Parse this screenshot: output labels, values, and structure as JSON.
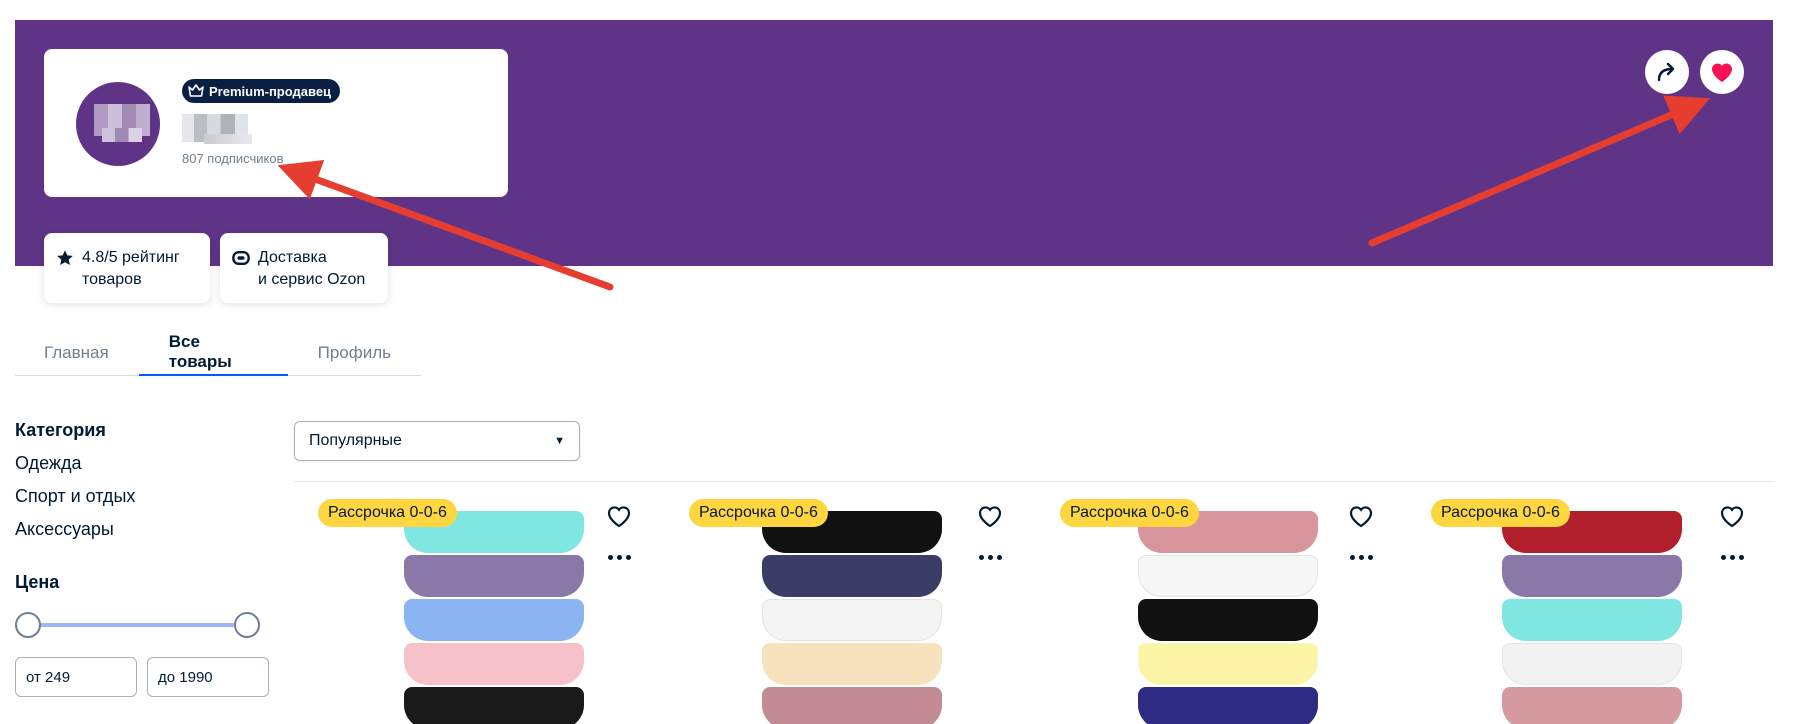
{
  "colors": {
    "banner": "#5f3487",
    "accent": "#005bff",
    "badge": "#ffd640",
    "heart": "#f91155",
    "annotation_arrow": "#e53e30"
  },
  "seller": {
    "premium_label": "Premium-продавец",
    "subscribers": "807 подписчиков"
  },
  "chips": {
    "rating_line1": "4.8/5 рейтинг",
    "rating_line2": "товаров",
    "delivery_line1": "Доставка",
    "delivery_line2": "и сервис Ozon"
  },
  "tabs": [
    {
      "label": "Главная",
      "active": false
    },
    {
      "label": "Все товары",
      "active": true
    },
    {
      "label": "Профиль",
      "active": false
    }
  ],
  "filters": {
    "category_title": "Категория",
    "categories": [
      "Одежда",
      "Спорт и отдых",
      "Аксессуары"
    ],
    "price_title": "Цена",
    "price_from": "от 249",
    "price_to": "до 1990"
  },
  "sort": {
    "selected": "Популярные"
  },
  "products": [
    {
      "badge": "Рассрочка 0-0-6",
      "stripes": [
        "#7fe6e1",
        "#8a78a8",
        "#8ab4f2",
        "#f4c2c8",
        "#1a1a1a"
      ]
    },
    {
      "badge": "Рассрочка 0-0-6",
      "stripes": [
        "#111111",
        "#3a3d66",
        "#f4f4f4",
        "#f6e3bd",
        "#c38b93"
      ]
    },
    {
      "badge": "Рассрочка 0-0-6",
      "stripes": [
        "#d9959c",
        "#f6f6f6",
        "#111111",
        "#fbf3a6",
        "#2e2b82"
      ]
    },
    {
      "badge": "Рассрочка 0-0-6",
      "stripes": [
        "#b21f2d",
        "#8a78a8",
        "#7fe6e1",
        "#f2f2f2",
        "#d59aa0"
      ]
    }
  ]
}
